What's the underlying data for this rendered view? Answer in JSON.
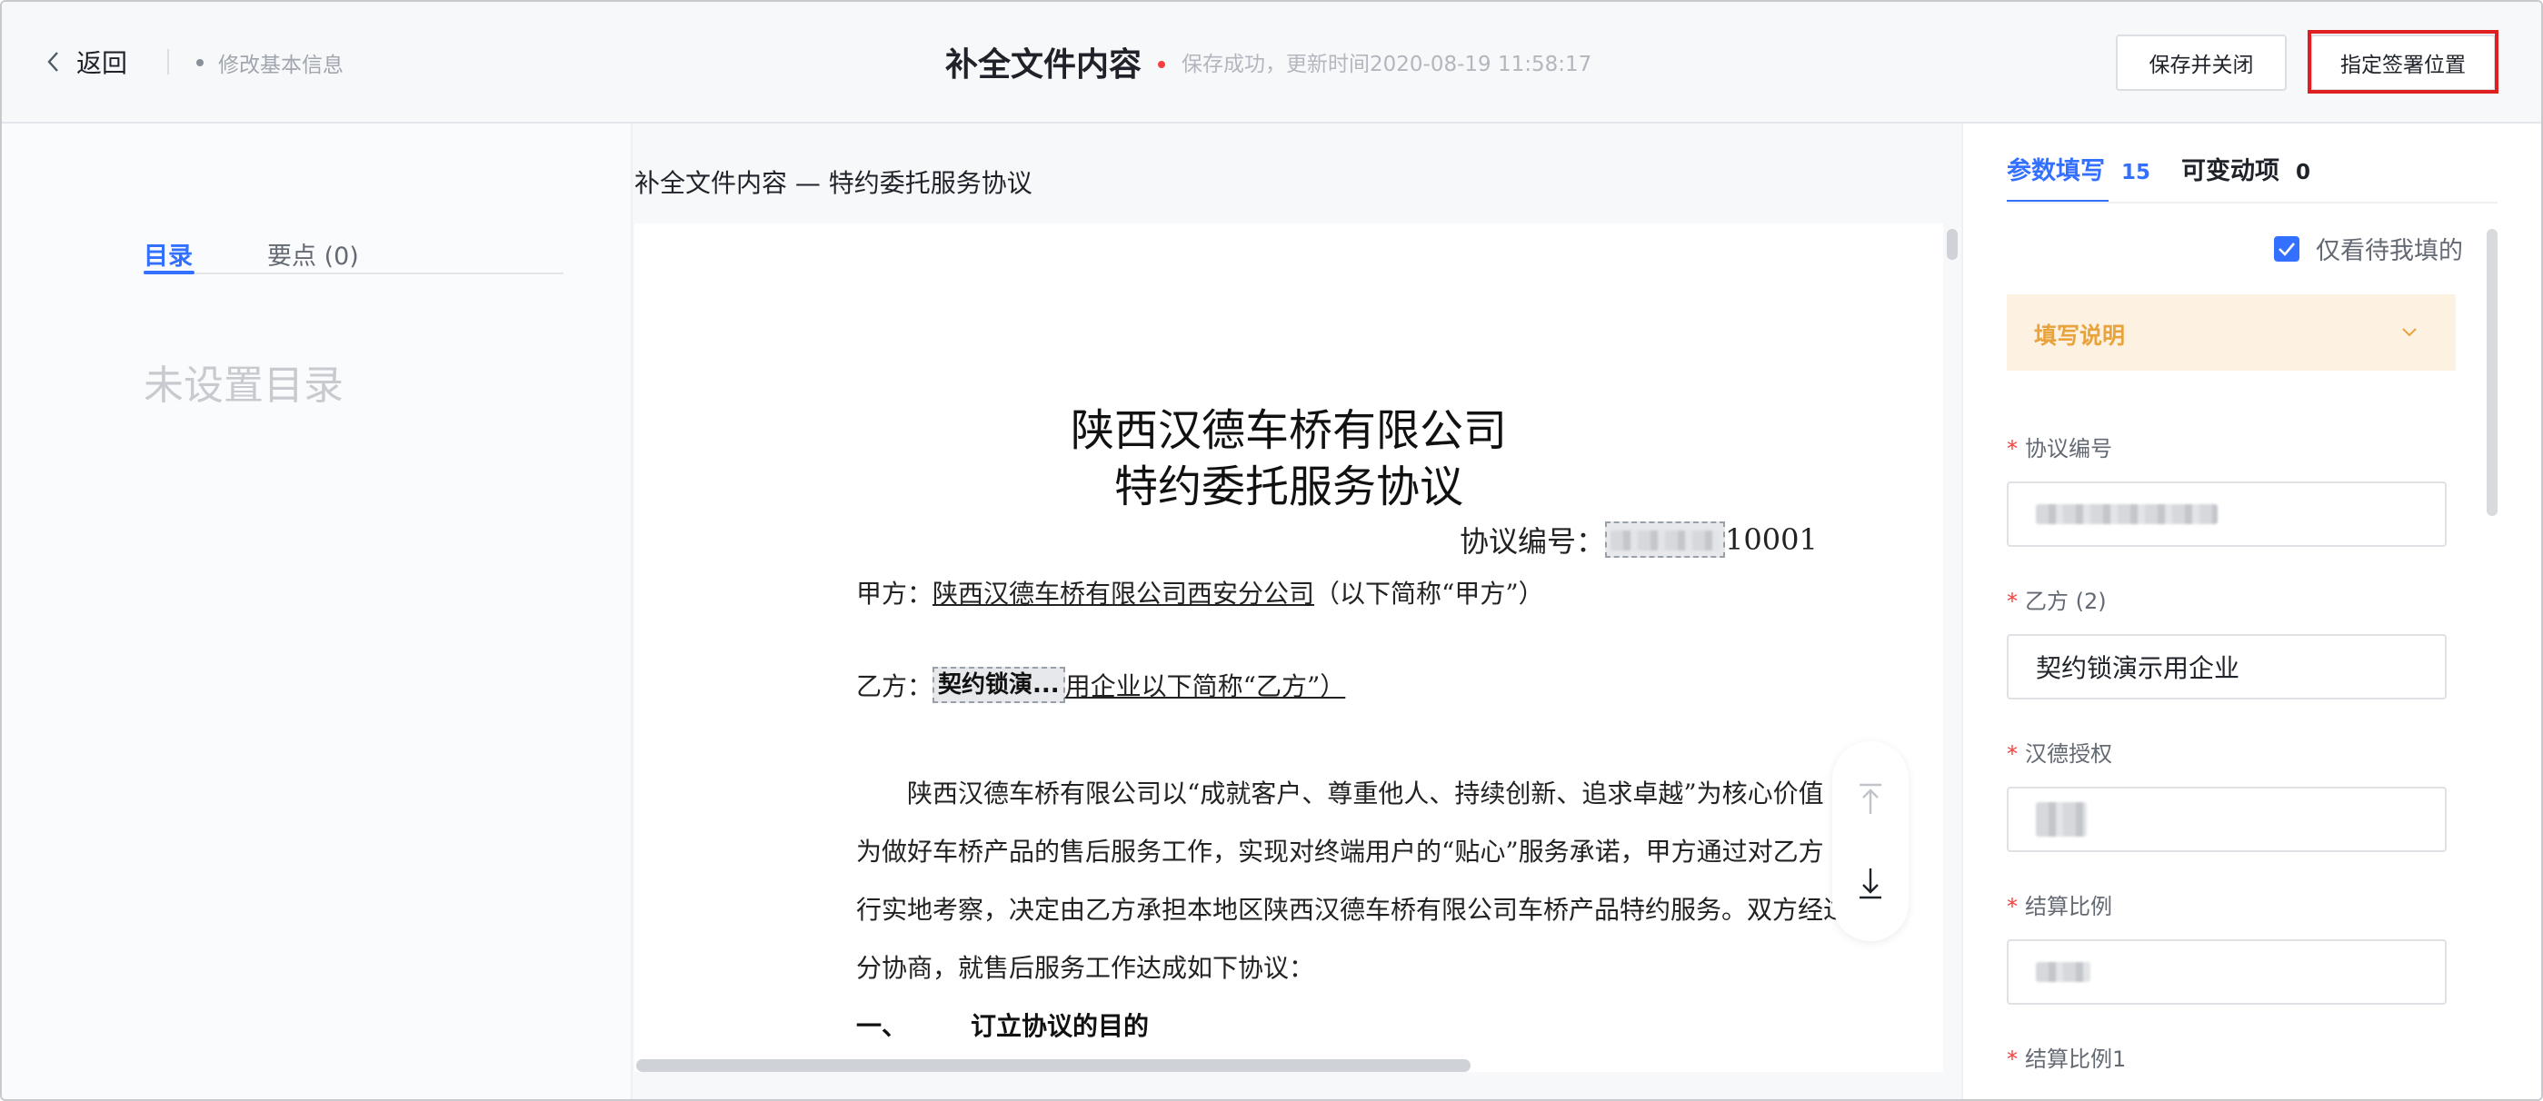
{
  "header": {
    "back_label": "返回",
    "breadcrumb": "修改基本信息",
    "title": "补全文件内容",
    "save_status": "保存成功，更新时间2020-08-19 11:58:17",
    "save_close_label": "保存并关闭",
    "sign_position_label": "指定签署位置"
  },
  "left_panel": {
    "tabs": [
      {
        "label": "目录"
      },
      {
        "label": "要点 (0)"
      }
    ],
    "empty_text": "未设置目录"
  },
  "document": {
    "heading": "补全文件内容 — 特约委托服务协议",
    "title_line1": "陕西汉德车桥有限公司",
    "title_line2": "特约委托服务协议",
    "agreement_no_label": "协议编号：",
    "agreement_no_suffix": "10001",
    "party_a_label": "甲方：",
    "party_a_name": "陕西汉德车桥有限公司西安分公司",
    "party_a_suffix": "（以下简称“甲方”）",
    "party_b_label": "乙方：",
    "party_b_field": "契约锁演...",
    "party_b_suffix": "用企业以下简称“乙方”）",
    "paragraph_lines": [
      "陕西汉德车桥有限公司以“成就客户、尊重他人、持续创新、追求卓越”为核心价值",
      "为做好车桥产品的售后服务工作，实现对终端用户的“贴心”服务承诺，甲方通过对乙方",
      "行实地考察，决定由乙方承担本地区陕西汉德车桥有限公司车桥产品特约服务。双方经过",
      "分协商，就售后服务工作达成如下协议："
    ],
    "section_number": "一、",
    "section_title": "订立协议的目的"
  },
  "right_panel": {
    "tab_params": {
      "label": "参数填写",
      "count": "15"
    },
    "tab_variables": {
      "label": "可变动项",
      "count": "0"
    },
    "only_mine_label": "仅看待我填的",
    "notice_label": "填写说明",
    "fields": [
      {
        "label": "协议编号",
        "value": ""
      },
      {
        "label": "乙方 (2)",
        "value": "契约锁演示用企业"
      },
      {
        "label": "汉德授权",
        "value": ""
      },
      {
        "label": "结算比例",
        "value": ""
      },
      {
        "label": "结算比例1",
        "value": ""
      }
    ]
  },
  "colors": {
    "accent": "#3370ff",
    "required": "#f53f3f",
    "notice_bg": "#fdf1e1",
    "notice_text": "#e8a33d",
    "highlight_box": "#e02020"
  }
}
